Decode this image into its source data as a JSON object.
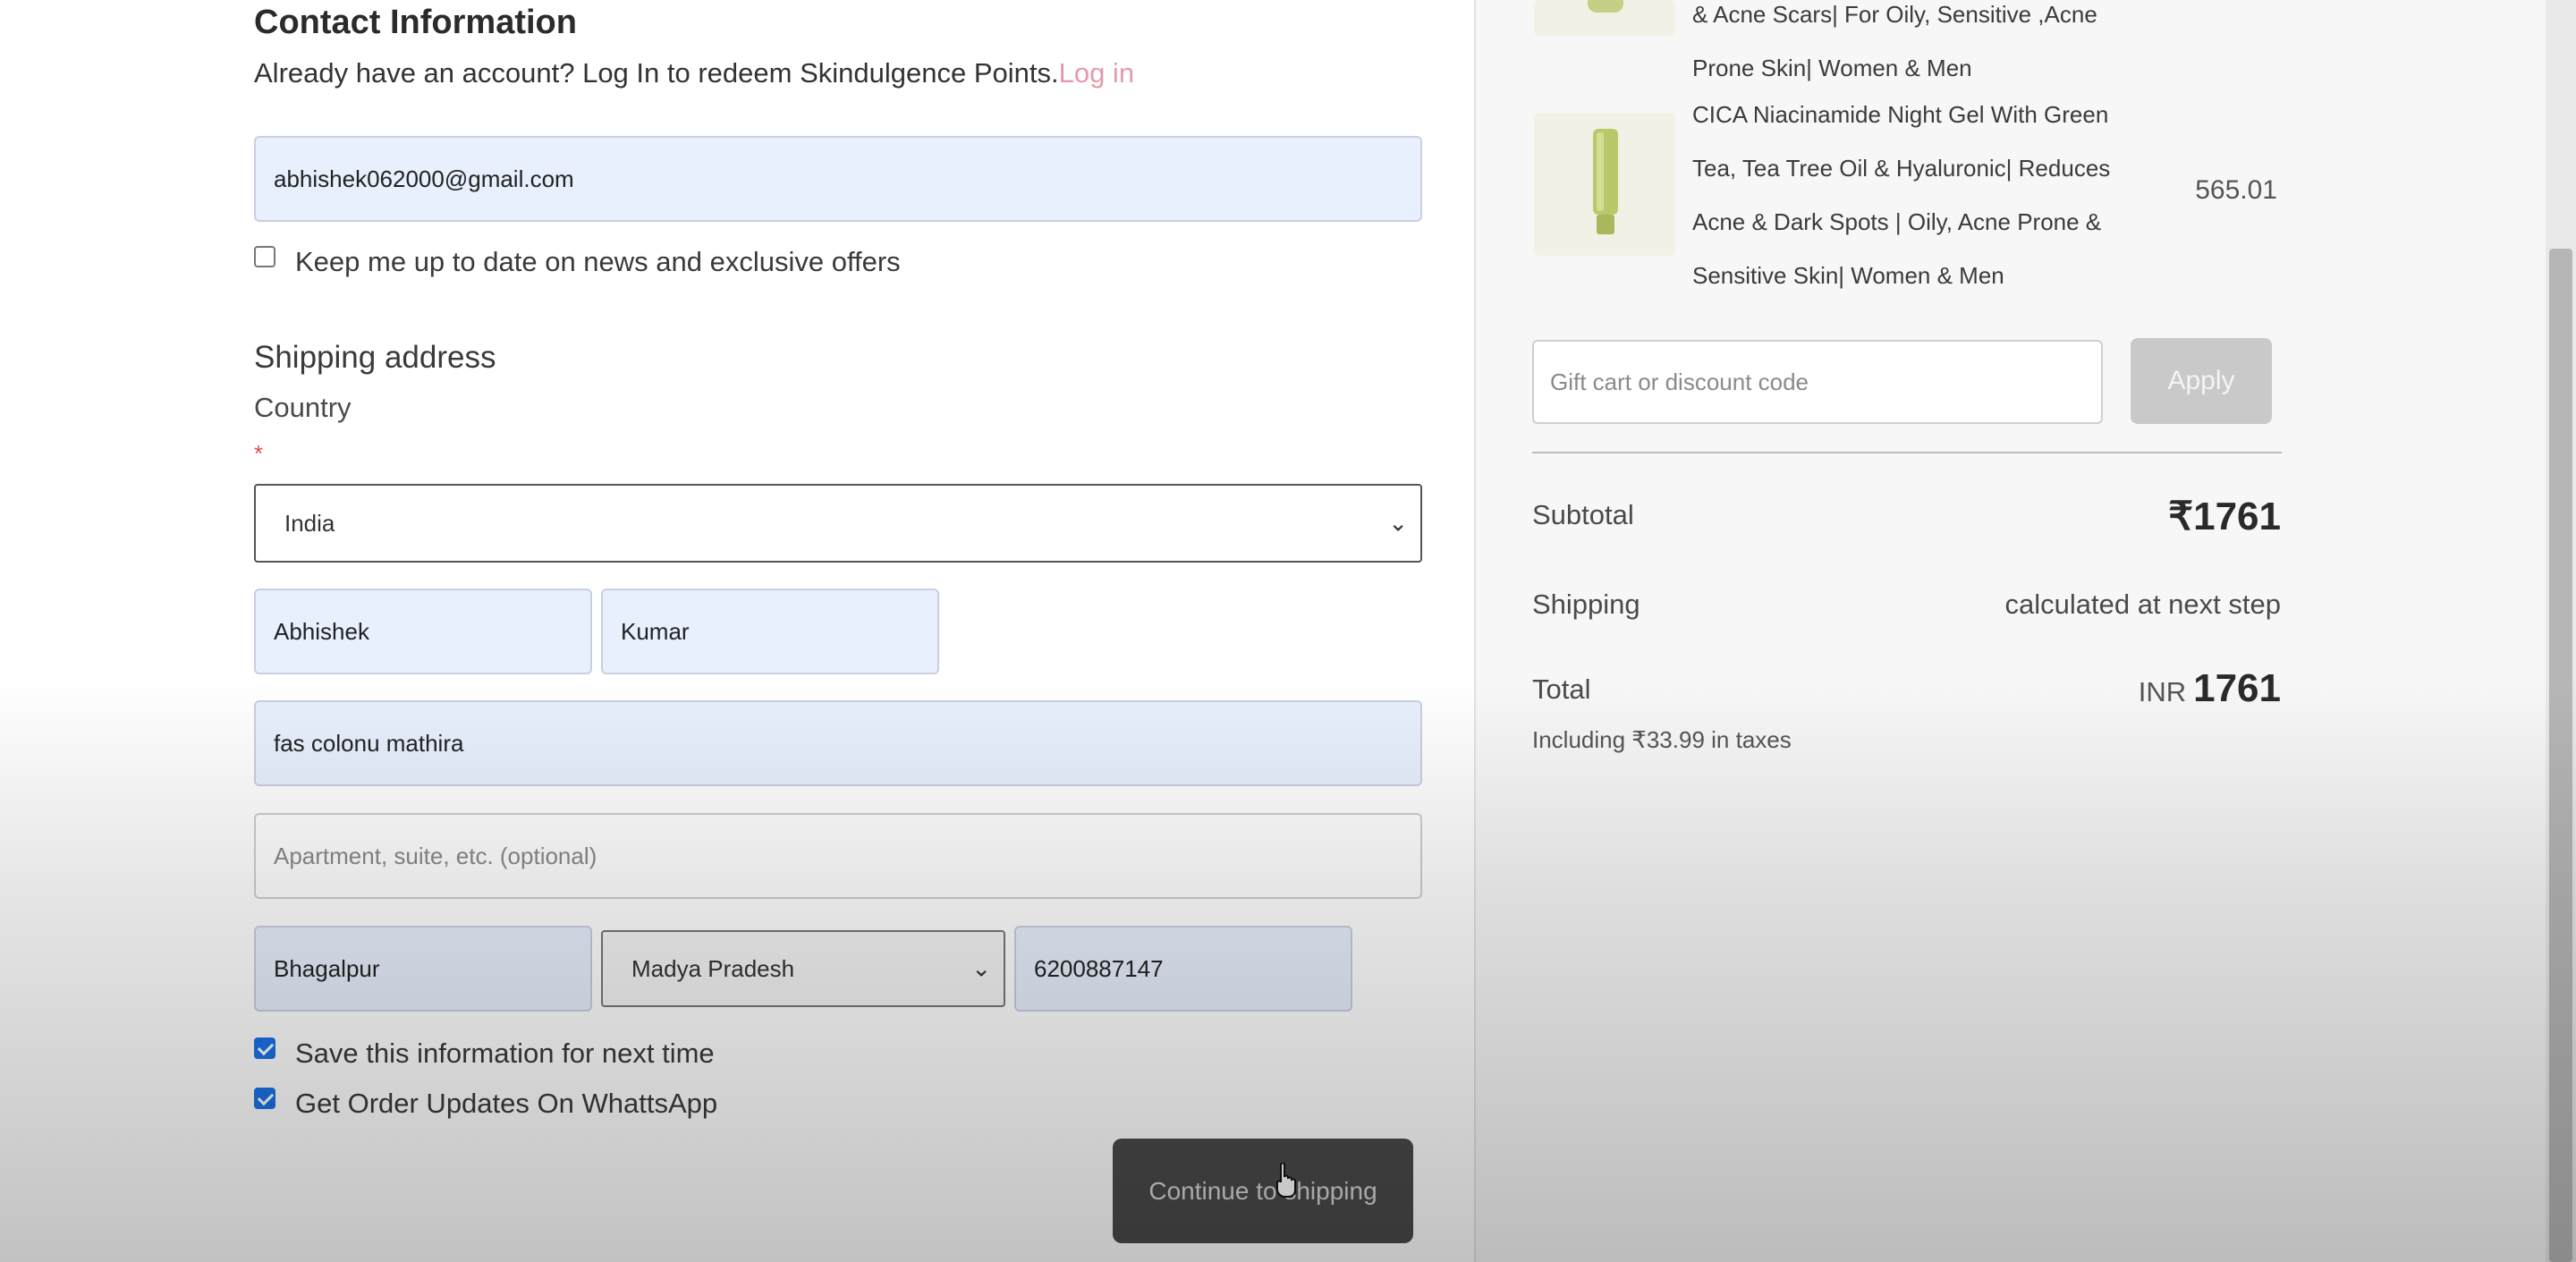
{
  "contact": {
    "heading": "Contact Information",
    "account_prompt": "Already have an account? Log In to redeem Skindulgence Points.",
    "login_link": "Log in",
    "email_value": "abhishek062000@gmail.com",
    "news_label": "Keep me up to date on news and exclusive offers",
    "news_checked": false
  },
  "shipping": {
    "heading": "Shipping address",
    "country_label": "Country",
    "required_mark": "*",
    "country_value": "India",
    "first_name": "Abhishek",
    "last_name": "Kumar",
    "address": "fas colonu  mathira",
    "apartment_placeholder": "Apartment, suite, etc. (optional)",
    "city": "Bhagalpur",
    "state": "Madya Pradesh",
    "phone": "6200887147",
    "save_info_label": "Save this information for next time",
    "save_info_checked": true,
    "whatsapp_label": "Get Order Updates On WhattsApp",
    "whatsapp_checked": true,
    "continue_button": "Continue to shipping"
  },
  "summary": {
    "prev_product_text": "& Acne Scars| For Oily, Sensitive ,Acne Prone Skin| Women & Men",
    "product_name": "CICA Niacinamide Night Gel With Green Tea, Tea Tree Oil & Hyaluronic| Reduces Acne & Dark Spots | Oily, Acne Prone & Sensitive Skin| Women & Men",
    "product_price": "565.01",
    "discount_placeholder": "Gift cart or discount code",
    "apply_button": "Apply",
    "subtotal_label": "Subtotal",
    "subtotal_value": "₹1761",
    "shipping_label": "Shipping",
    "shipping_value": "calculated at next step",
    "total_label": "Total",
    "total_currency": "INR",
    "total_value": "1761",
    "taxes_note": "Including ₹33.99 in taxes"
  },
  "colors": {
    "link_pink": "#e59aa9",
    "autofill_blue": "#e8f0fe",
    "button_dark": "#4a4a4a",
    "apply_gray": "#c9c9c9",
    "checkbox_blue": "#1a73e8"
  }
}
